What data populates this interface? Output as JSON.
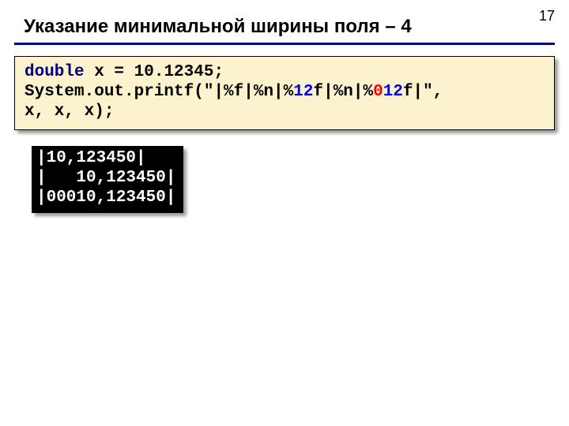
{
  "page_number": "17",
  "title": "Указание минимальной ширины поля – 4",
  "code": {
    "kw_double": "double",
    "var_decl_rest": " x = 10.12345;",
    "line2_a": "System.out.printf(\"|%f|%n|%",
    "line2_n1": "12",
    "line2_b": "f|%n|%",
    "line2_n2": "0",
    "line2_n3": "12",
    "line2_c": "f|\",",
    "line3": "x, x, x);"
  },
  "output": {
    "l1": "|10,123450|",
    "l2": "|   10,123450|",
    "l3": "|00010,123450|"
  }
}
